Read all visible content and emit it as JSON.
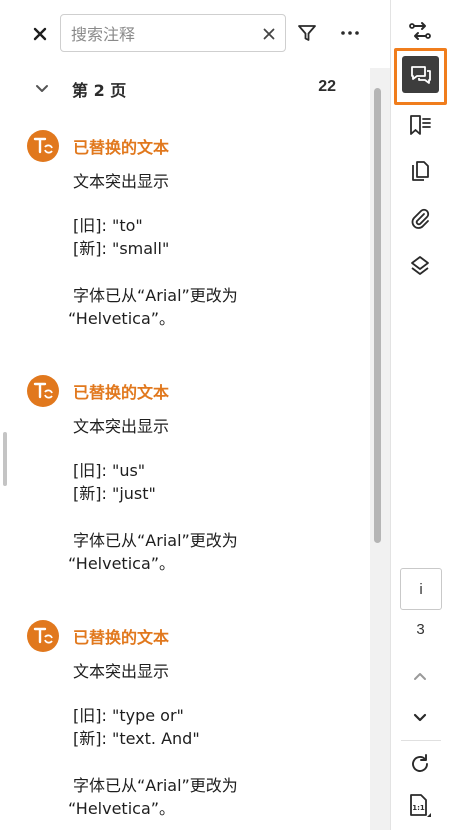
{
  "search": {
    "placeholder": "搜索注释",
    "value": ""
  },
  "page_group": {
    "label": "第 2 页",
    "count": "22"
  },
  "comments": [
    {
      "title": "已替换的文本",
      "type": "文本突出显示",
      "old": "[旧]: \"to\"",
      "new": "[新]: \"small\"",
      "font_line1": "字体已从“Arial”更改为",
      "font_line2": "“Helvetica”。"
    },
    {
      "title": "已替换的文本",
      "type": "文本突出显示",
      "old": "[旧]: \"us\"",
      "new": "[新]: \"just\"",
      "font_line1": "字体已从“Arial”更改为",
      "font_line2": "“Helvetica”。"
    },
    {
      "title": "已替换的文本",
      "type": "文本突出显示",
      "old": "[旧]: \"type or\"",
      "new": "[新]: \"text.  And\"",
      "font_line1": "字体已从“Arial”更改为",
      "font_line2": "“Helvetica”。"
    }
  ],
  "navigator": {
    "current_page": "i",
    "total_pages": "3"
  },
  "colors": {
    "accent": "#f07d1c",
    "comment_title": "#e1781d",
    "avatar": "#e1781d",
    "active_tool_bg": "#3d3d3d"
  },
  "icons": {
    "close": "close-icon",
    "clear": "clear-icon",
    "filter": "filter-icon",
    "more": "more-icon",
    "collapse": "chevron-down-icon",
    "avatar": "text-replace-icon",
    "rail": [
      "compare-icon",
      "comments-icon",
      "bookmarks-icon",
      "pages-icon",
      "attachments-icon",
      "layers-icon",
      "chevron-up-icon",
      "chevron-down-icon",
      "rotate-icon",
      "actual-size-icon"
    ]
  }
}
